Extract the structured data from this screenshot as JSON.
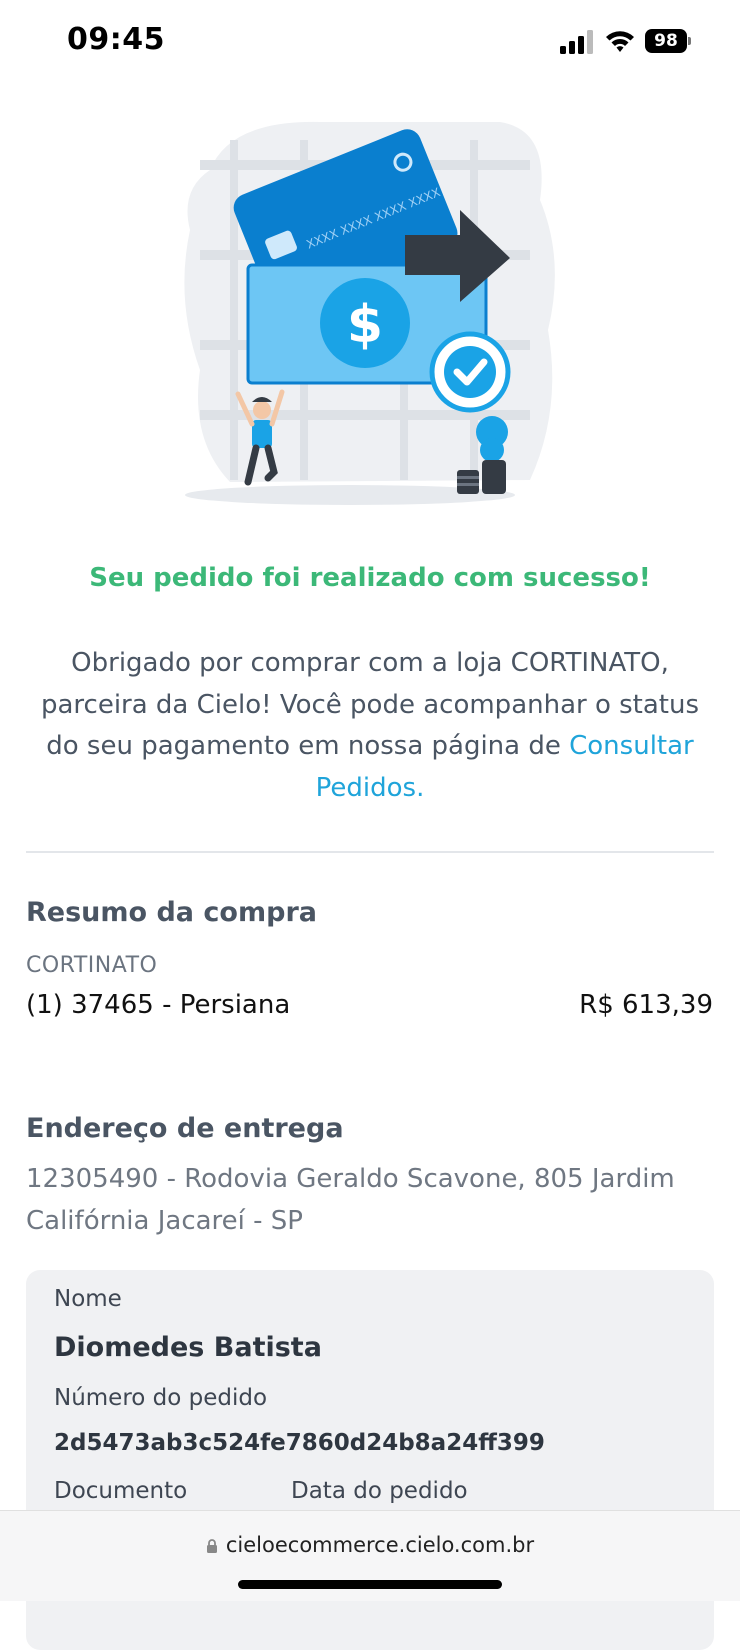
{
  "status_bar": {
    "time": "09:45",
    "battery": "98",
    "icons": [
      "cellular-signal-icon",
      "wifi-icon",
      "battery-icon"
    ]
  },
  "illustration": {
    "card_text": "XXXX XXXX XXXX XXXX",
    "currency_symbol": "$",
    "icons": [
      "credit-card-icon",
      "banknote-icon",
      "arrow-right-icon",
      "checkmark-icon",
      "person-icon",
      "plant-icon"
    ]
  },
  "success": {
    "title": "Seu pedido foi realizado com sucesso!",
    "message": "Obrigado por comprar com a loja CORTINATO, parceira da Cielo! Você pode acompanhar o status do seu pagamento em nossa página de",
    "link": "Consultar Pedidos."
  },
  "summary": {
    "title": "Resumo da compra",
    "store": "CORTINATO",
    "items": [
      {
        "description": "(1) 37465 - Persiana",
        "price": "R$ 613,39"
      }
    ]
  },
  "delivery": {
    "title": "Endereço de entrega",
    "address": "12305490 - Rodovia Geraldo Scavone, 805 Jardim Califórnia Jacareí - SP"
  },
  "details": {
    "name_label": "Nome",
    "name_value": "Diomedes Batista",
    "order_label": "Número do pedido",
    "order_value": "2d5473ab3c524fe7860d24b8a24ff399",
    "document_label": "Documento",
    "date_label": "Data do pedido"
  },
  "browser": {
    "url": "cieloecommerce.cielo.com.br"
  },
  "colors": {
    "success": "#3cb878",
    "link": "#1fa4da",
    "accent_blue": "#0a7fcf"
  }
}
